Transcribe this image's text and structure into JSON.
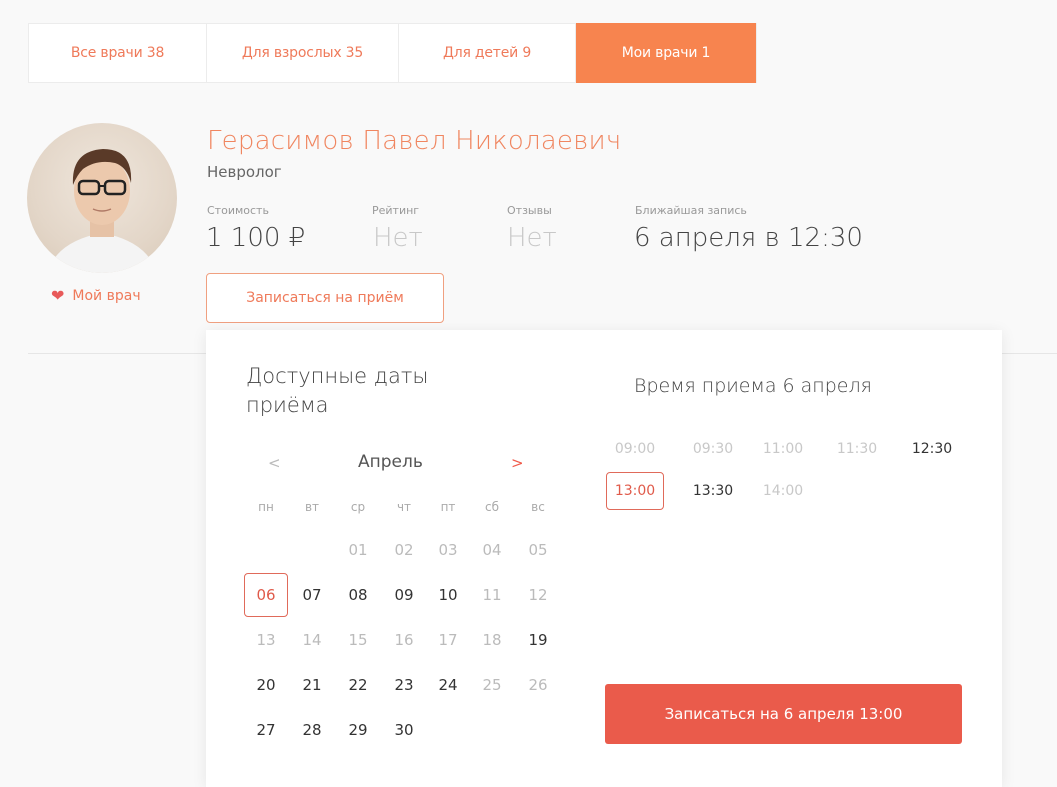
{
  "tabs": [
    {
      "label": "Все врачи 38",
      "active": false
    },
    {
      "label": "Для взрослых 35",
      "active": false
    },
    {
      "label": "Для детей 9",
      "active": false
    },
    {
      "label": "Мои врачи 1",
      "active": true
    }
  ],
  "doctor": {
    "name": "Герасимов Павел Николаевич",
    "specialty": "Невролог",
    "my_doctor_label": "Мой врач",
    "stats": {
      "cost_label": "Стоимость",
      "cost_value": "1 100 ₽",
      "rating_label": "Рейтинг",
      "rating_value": "Нет",
      "reviews_label": "Отзывы",
      "reviews_value": "Нет",
      "nearest_label": "Ближайшая запись",
      "nearest_value": "6 апреля в 12:30"
    },
    "book_button": "Записаться на приём"
  },
  "calendar": {
    "title": "Доступные даты приёма",
    "prev": "<",
    "next": ">",
    "month": "Апрель",
    "weekdays": [
      "пн",
      "вт",
      "ср",
      "чт",
      "пт",
      "сб",
      "вс"
    ],
    "weeks": [
      [
        null,
        null,
        {
          "d": "01",
          "a": false
        },
        {
          "d": "02",
          "a": false
        },
        {
          "d": "03",
          "a": false
        },
        {
          "d": "04",
          "a": false
        },
        {
          "d": "05",
          "a": false
        }
      ],
      [
        {
          "d": "06",
          "a": true,
          "s": true
        },
        {
          "d": "07",
          "a": true
        },
        {
          "d": "08",
          "a": true
        },
        {
          "d": "09",
          "a": true
        },
        {
          "d": "10",
          "a": true
        },
        {
          "d": "11",
          "a": false
        },
        {
          "d": "12",
          "a": false
        }
      ],
      [
        {
          "d": "13",
          "a": false
        },
        {
          "d": "14",
          "a": false
        },
        {
          "d": "15",
          "a": false
        },
        {
          "d": "16",
          "a": false
        },
        {
          "d": "17",
          "a": false
        },
        {
          "d": "18",
          "a": false
        },
        {
          "d": "19",
          "a": true
        }
      ],
      [
        {
          "d": "20",
          "a": true
        },
        {
          "d": "21",
          "a": true
        },
        {
          "d": "22",
          "a": true
        },
        {
          "d": "23",
          "a": true
        },
        {
          "d": "24",
          "a": true
        },
        {
          "d": "25",
          "a": false
        },
        {
          "d": "26",
          "a": false
        }
      ],
      [
        {
          "d": "27",
          "a": true
        },
        {
          "d": "28",
          "a": true
        },
        {
          "d": "29",
          "a": true
        },
        {
          "d": "30",
          "a": true
        },
        null,
        null,
        null
      ]
    ]
  },
  "times": {
    "title": "Время приема 6 апреля",
    "rows": [
      [
        {
          "t": "09:00",
          "a": false
        },
        {
          "t": "09:30",
          "a": false
        },
        {
          "t": "11:00",
          "a": false
        },
        {
          "t": "11:30",
          "a": false
        },
        {
          "t": "12:30",
          "a": true
        }
      ],
      [
        {
          "t": "13:00",
          "a": true,
          "s": true
        },
        {
          "t": "13:30",
          "a": true
        },
        {
          "t": "14:00",
          "a": false
        }
      ]
    ],
    "confirm_button": "Записаться на 6 апреля 13:00"
  },
  "colors": {
    "accent": "#f7844f",
    "accent_text": "#ef7a5a",
    "confirm": "#ea5b4b"
  }
}
